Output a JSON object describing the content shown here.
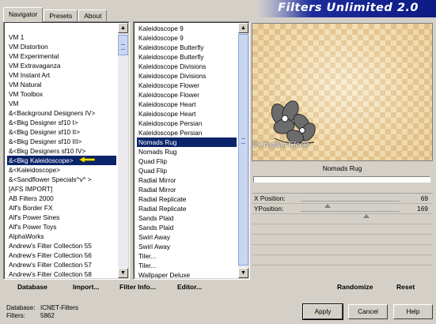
{
  "banner": {
    "title": "Filters Unlimited 2.0"
  },
  "tabs": [
    {
      "label": "Navigator",
      "active": true
    },
    {
      "label": "Presets",
      "active": false
    },
    {
      "label": "About",
      "active": false
    }
  ],
  "categories": [
    "VM 1",
    "VM Distortion",
    "VM Experimental",
    "VM Extravaganza",
    "VM Instant Art",
    "VM Natural",
    "VM Toolbox",
    "VM",
    "&<Background Designers IV>",
    "&<Bkg Designer sf10 I>",
    "&<Bkg Designer sf10 II>",
    "&<Bkg Designer sf10 III>",
    "&<Bkg Designers sf10 IV>",
    "&<Bkg Kaleidoscope>",
    "&<Kaleidoscope>",
    "&<Sandflower Specials^v^ >",
    "[AFS IMPORT]",
    "AB Filters 2000",
    "Alf's Border FX",
    "Alf's Power Sines",
    "Alf's Power Toys",
    "AlphaWorks",
    "Andrew's Filter Collection 55",
    "Andrew's Filter Collection 56",
    "Andrew's Filter Collection 57",
    "Andrew's Filter Collection 58"
  ],
  "filters": [
    "Kaleidoscope 9",
    "Kaleidoscope 9",
    "Kaleidoscope Butterfly",
    "Kaleidoscope Butterfly",
    "Kaleidoscope Divisions",
    "Kaleidoscope Divisions",
    "Kaleidoscope Flower",
    "Kaleidoscope Flower",
    "Kaleidoscope Heart",
    "Kaleidoscope Heart",
    "Kaleidoscope Persian",
    "Kaleidoscope Persian",
    "Nomads Rug",
    "Nomads Rug",
    "Quad Flip",
    "Quad Flip",
    "Radial Mirror",
    "Radial Mirror",
    "Radial Replicate",
    "Radial Replicate",
    "Sands Plaid",
    "Sands Plaid",
    "Swirl Away",
    "Swirl Away",
    "Tiler...",
    "Tiler...",
    "Wallpaper Deluxe"
  ],
  "selected_category_index": 13,
  "selected_filter_index": 12,
  "preview": {
    "watermark": "©Creation Cloclo"
  },
  "filter_name": "Nomads Rug",
  "params": [
    {
      "label": "X Position:",
      "value": "69",
      "level": 0.27
    },
    {
      "label": "YPosition:",
      "value": "169",
      "level": 0.66
    }
  ],
  "toolbar": {
    "database": "Database",
    "import": "Import...",
    "filter_info": "Filter Info...",
    "editor": "Editor...",
    "randomize": "Randomize",
    "reset": "Reset"
  },
  "status": {
    "database_label": "Database:",
    "database_value": "ICNET-Filters",
    "filters_label": "Filters:",
    "filters_value": "5862"
  },
  "buttons": {
    "apply": "Apply",
    "cancel": "Cancel",
    "help": "Help"
  }
}
